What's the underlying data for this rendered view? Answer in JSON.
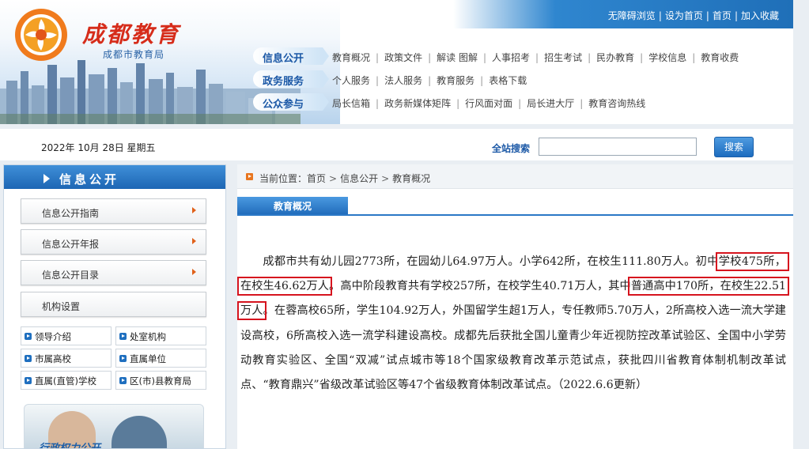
{
  "top_links": [
    "无障碍浏览",
    "设为首页",
    "首页",
    "加入收藏"
  ],
  "brand": {
    "title": "成都教育",
    "subtitle": "成都市教育局"
  },
  "nav": [
    {
      "tag": "信息公开",
      "items": [
        "教育概况",
        "政策文件",
        "解读 图解",
        "人事招考",
        "招生考试",
        "民办教育",
        "学校信息",
        "教育收费"
      ]
    },
    {
      "tag": "政务服务",
      "items": [
        "个人服务",
        "法人服务",
        "教育服务",
        "表格下载"
      ]
    },
    {
      "tag": "公众参与",
      "items": [
        "局长信箱",
        "政务新媒体矩阵",
        "行风面对面",
        "局长进大厅",
        "教育咨询热线"
      ]
    }
  ],
  "date": "2022年 10月 28日 星期五",
  "search": {
    "label": "全站搜索",
    "value": "",
    "placeholder": "",
    "button": "搜索"
  },
  "sidebar": {
    "title": "信息公开",
    "items": [
      "信息公开指南",
      "信息公开年报",
      "信息公开目录",
      "机构设置"
    ],
    "grid": [
      "领导介绍",
      "处室机构",
      "市属高校",
      "直属单位",
      "直属(直管)学校",
      "区(市)县教育局"
    ],
    "promo_label": "行政权力公开"
  },
  "breadcrumb": {
    "prefix": "当前位置：",
    "items": [
      "首页",
      "信息公开",
      "教育概况"
    ]
  },
  "tab_label": "教育概况",
  "article": {
    "p1": "成都市共有幼儿园2773所，在园幼儿64.97万人。小学642所，在校生111.80万人。初中",
    "h1": "学校475所，在校生46.62万人",
    "p2": "。高中阶段教育共有学校257所，在校学生40.71万人，其中",
    "h2": "普通高中170所，在校生22.51万人",
    "p3": "。在蓉高校65所，学生104.92万人，外国留学生超1万人，专任教师5.70万人，2所高校入选一流大学建设高校，6所高校入选一流学科建设高校。成都先后获批全国儿童青少年近视防控改革试验区、全国中小学劳动教育实验区、全国“双减”试点城市等18个国家级教育改革示范试点，获批四川省教育体制机制改革试点、“教育鼎兴”省级改革试验区等47个省级教育体制改革试点。（2022.6.6更新）"
  },
  "colors": {
    "brand_red": "#d62c1a",
    "nav_blue": "#1d66b4",
    "highlight_box": "#d6141e"
  }
}
